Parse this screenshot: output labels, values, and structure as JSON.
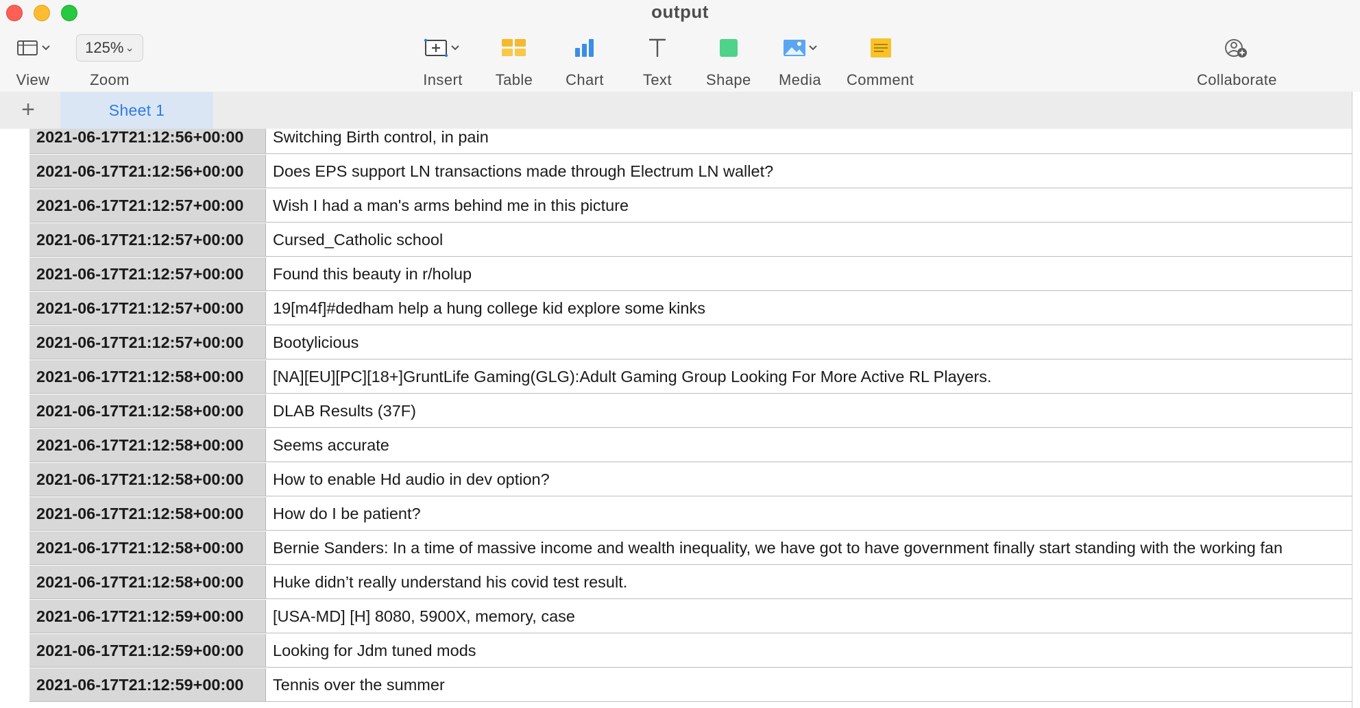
{
  "window": {
    "title": "output"
  },
  "toolbar": {
    "view_label": "View",
    "zoom_value": "125%",
    "zoom_label": "Zoom",
    "insert_label": "Insert",
    "table_label": "Table",
    "chart_label": "Chart",
    "text_label": "Text",
    "shape_label": "Shape",
    "media_label": "Media",
    "comment_label": "Comment",
    "collaborate_label": "Collaborate"
  },
  "sheets": {
    "add_symbol": "+",
    "active": "Sheet 1"
  },
  "rows": [
    {
      "timestamp": "2021-06-17T21:12:56+00:00",
      "title": "Switching Birth control, in pain"
    },
    {
      "timestamp": "2021-06-17T21:12:56+00:00",
      "title": "Does EPS support LN transactions made through Electrum LN wallet?"
    },
    {
      "timestamp": "2021-06-17T21:12:57+00:00",
      "title": "Wish I had a man's arms behind me in this picture"
    },
    {
      "timestamp": "2021-06-17T21:12:57+00:00",
      "title": "Cursed_Catholic school"
    },
    {
      "timestamp": "2021-06-17T21:12:57+00:00",
      "title": "Found this beauty in r/holup"
    },
    {
      "timestamp": "2021-06-17T21:12:57+00:00",
      "title": "19[m4f]#dedham help a hung college kid explore some kinks"
    },
    {
      "timestamp": "2021-06-17T21:12:57+00:00",
      "title": "Bootylicious"
    },
    {
      "timestamp": "2021-06-17T21:12:58+00:00",
      "title": "[NA][EU][PC][18+]GruntLife Gaming(GLG):Adult Gaming Group Looking For More Active RL Players."
    },
    {
      "timestamp": "2021-06-17T21:12:58+00:00",
      "title": "DLAB Results (37F)"
    },
    {
      "timestamp": "2021-06-17T21:12:58+00:00",
      "title": "Seems accurate"
    },
    {
      "timestamp": "2021-06-17T21:12:58+00:00",
      "title": "How to enable Hd audio in dev option?"
    },
    {
      "timestamp": "2021-06-17T21:12:58+00:00",
      "title": "How do I be patient?"
    },
    {
      "timestamp": "2021-06-17T21:12:58+00:00",
      "title": "Bernie Sanders: In a time of massive income and wealth inequality, we have got to have government finally start standing with the working fan"
    },
    {
      "timestamp": "2021-06-17T21:12:58+00:00",
      "title": "Huke didn’t really understand his covid test result."
    },
    {
      "timestamp": "2021-06-17T21:12:59+00:00",
      "title": "[USA-MD] [H] 8080, 5900X, memory, case"
    },
    {
      "timestamp": "2021-06-17T21:12:59+00:00",
      "title": "Looking for Jdm tuned mods"
    },
    {
      "timestamp": "2021-06-17T21:12:59+00:00",
      "title": "Tennis over the summer"
    }
  ]
}
